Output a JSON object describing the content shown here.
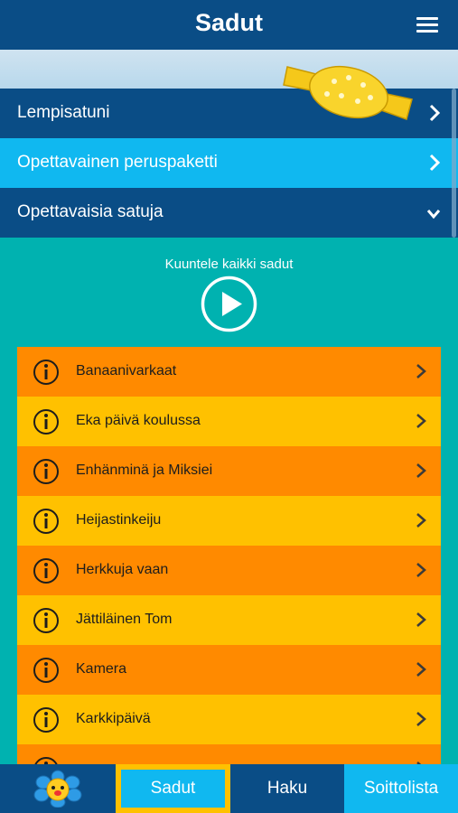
{
  "header": {
    "title": "Sadut"
  },
  "sections": [
    {
      "label": "Lempisatuni",
      "expanded": false
    },
    {
      "label": "Opettavainen peruspaketti",
      "expanded": false
    },
    {
      "label": "Opettavaisia satuja",
      "expanded": true
    }
  ],
  "player": {
    "listen_all_label": "Kuuntele kaikki sadut"
  },
  "stories": [
    {
      "title": "Banaanivarkaat"
    },
    {
      "title": "Eka päivä koulussa"
    },
    {
      "title": "Enhänminä ja Miksiei"
    },
    {
      "title": "Heijastinkeiju"
    },
    {
      "title": "Herkkuja vaan"
    },
    {
      "title": "Jättiläinen Tom"
    },
    {
      "title": "Kamera"
    },
    {
      "title": "Karkkipäivä"
    },
    {
      "title": ""
    }
  ],
  "tabs": [
    {
      "label": "",
      "icon": "flower-icon"
    },
    {
      "label": "Sadut",
      "active": true
    },
    {
      "label": "Haku"
    },
    {
      "label": "Soittolista"
    }
  ],
  "colors": {
    "navy": "#0a4d86",
    "light_blue": "#10b8f0",
    "teal": "#00b2b0",
    "orange": "#ff8a00",
    "yellow": "#ffc100"
  }
}
